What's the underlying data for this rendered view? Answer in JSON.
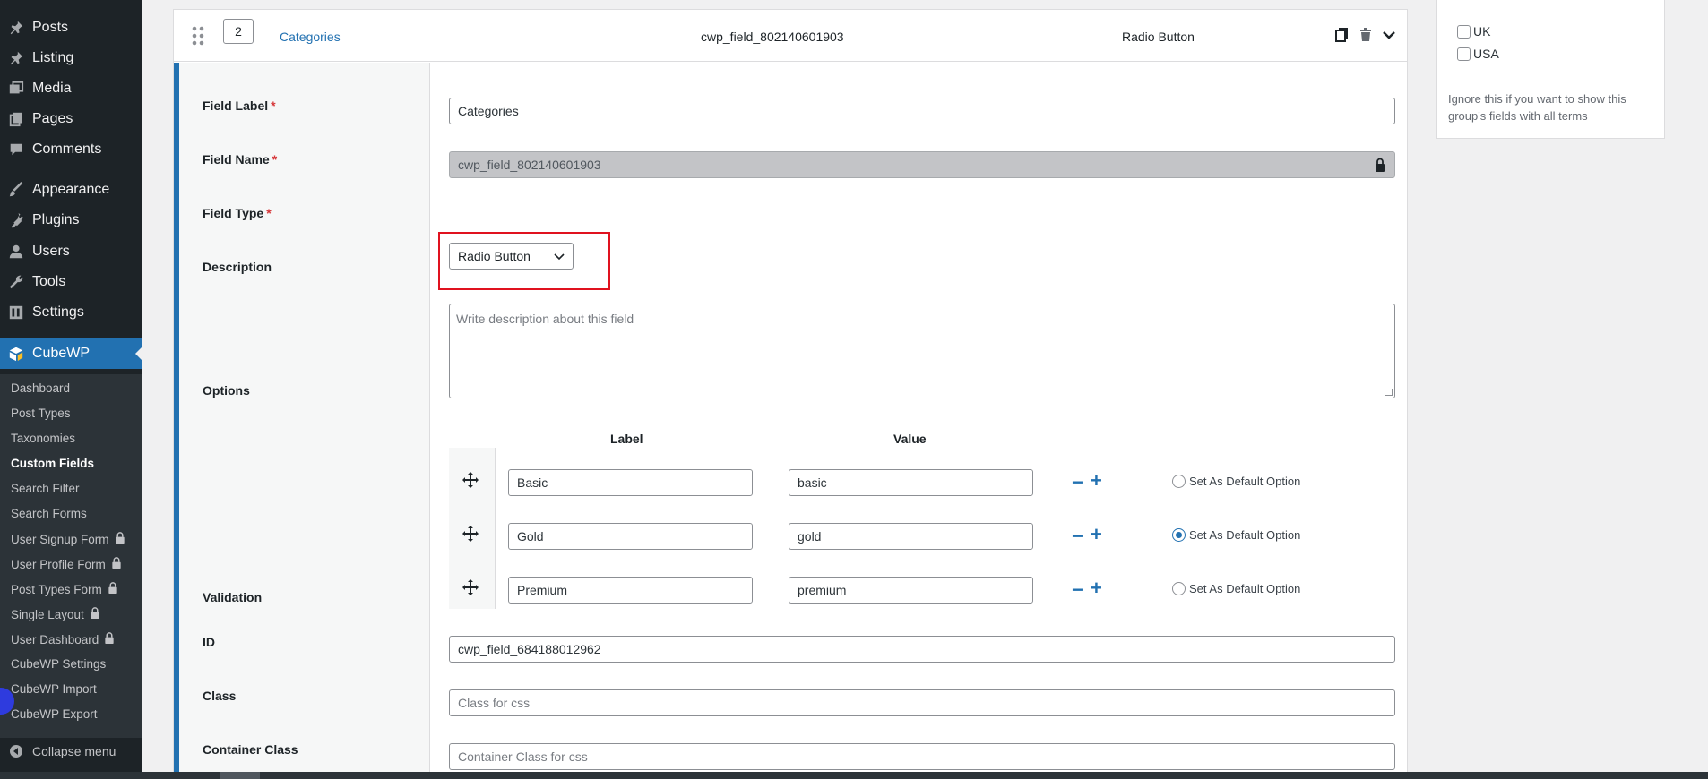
{
  "sidebar": {
    "items": [
      {
        "label": "Posts",
        "icon": "pin-icon"
      },
      {
        "label": "Listing",
        "icon": "pin-icon"
      },
      {
        "label": "Media",
        "icon": "media-icon"
      },
      {
        "label": "Pages",
        "icon": "pages-icon"
      },
      {
        "label": "Comments",
        "icon": "comments-icon"
      },
      {
        "label": "Appearance",
        "icon": "brush-icon"
      },
      {
        "label": "Plugins",
        "icon": "plug-icon"
      },
      {
        "label": "Users",
        "icon": "user-icon"
      },
      {
        "label": "Tools",
        "icon": "wrench-icon"
      },
      {
        "label": "Settings",
        "icon": "settings-icon"
      },
      {
        "label": "CubeWP",
        "icon": "cubewp-icon"
      }
    ],
    "submenu": [
      {
        "label": "Dashboard"
      },
      {
        "label": "Post Types"
      },
      {
        "label": "Taxonomies"
      },
      {
        "label": "Custom Fields"
      },
      {
        "label": "Search Filter"
      },
      {
        "label": "Search Forms"
      },
      {
        "label": "User Signup Form"
      },
      {
        "label": "User Profile Form"
      },
      {
        "label": "Post Types Form"
      },
      {
        "label": "Single Layout"
      },
      {
        "label": "User Dashboard"
      },
      {
        "label": "CubeWP Settings"
      },
      {
        "label": "CubeWP Import"
      },
      {
        "label": "CubeWP Export"
      }
    ],
    "collapse_label": "Collapse menu"
  },
  "field_header": {
    "order": "2",
    "title": "Categories",
    "name": "cwp_field_802140601903",
    "type": "Radio Button"
  },
  "form": {
    "field_label": {
      "label": "Field Label",
      "required": "*",
      "value": "Categories"
    },
    "field_name": {
      "label": "Field Name",
      "required": "*",
      "value": "cwp_field_802140601903"
    },
    "field_type": {
      "label": "Field Type",
      "required": "*",
      "value": "Radio Button"
    },
    "description": {
      "label": "Description",
      "placeholder": "Write description about this field"
    },
    "options": {
      "label": "Options",
      "col_label": "Label",
      "col_value": "Value",
      "default_text": "Set As Default Option",
      "rows": [
        {
          "label": "Basic",
          "value": "basic",
          "default": false
        },
        {
          "label": "Gold",
          "value": "gold",
          "default": true
        },
        {
          "label": "Premium",
          "value": "premium",
          "default": false
        }
      ]
    },
    "validation": {
      "label": "Validation",
      "enabled": false
    },
    "id": {
      "label": "ID",
      "value": "cwp_field_684188012962"
    },
    "class": {
      "label": "Class",
      "placeholder": "Class for css"
    },
    "container_class": {
      "label": "Container Class",
      "placeholder": "Container Class for css"
    }
  },
  "right_panel": {
    "terms": [
      {
        "label": "UK"
      },
      {
        "label": "USA"
      }
    ],
    "note": "Ignore this if you want to show this group's fields with all terms"
  },
  "colors": {
    "accent": "#2271b1",
    "highlight": "#e0121f",
    "sidebar": "#1d2327"
  }
}
